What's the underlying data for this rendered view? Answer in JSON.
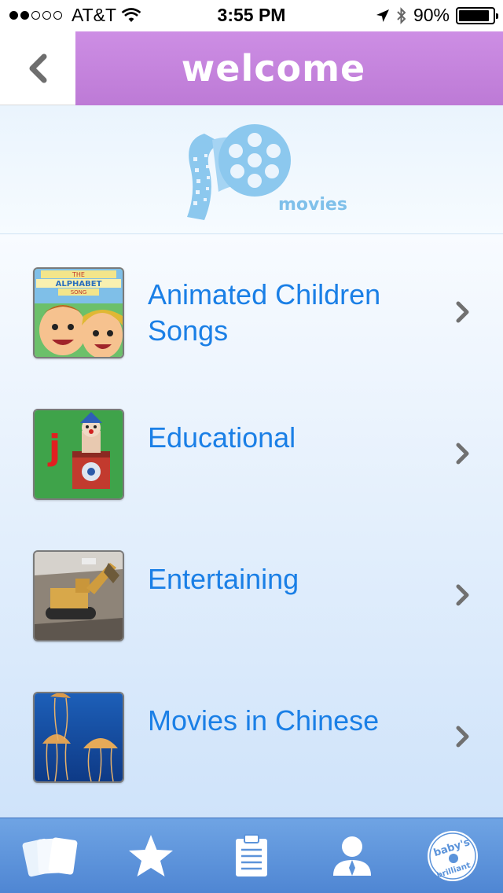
{
  "status_bar": {
    "carrier": "AT&T",
    "time": "3:55 PM",
    "battery_percent": "90%",
    "battery_level": 0.9,
    "signal_bars_filled": 2,
    "signal_bars_total": 5
  },
  "header": {
    "title": "welcome",
    "back_icon": "chevron-left-icon",
    "accent_color": "#c586de"
  },
  "banner": {
    "icon": "film-reel-icon",
    "label": "movies",
    "color": "#7fc0ea"
  },
  "list": {
    "items": [
      {
        "label": "Animated Children Songs",
        "thumb_text": [
          "THE",
          "ALPHABET",
          "SONG"
        ]
      },
      {
        "label": "Educational",
        "thumb_text": [
          "j"
        ]
      },
      {
        "label": "Entertaining"
      },
      {
        "label": "Movies in Chinese"
      }
    ],
    "text_color": "#1a7fe6"
  },
  "tab_bar": {
    "tabs": [
      {
        "icon": "cards-icon"
      },
      {
        "icon": "star-icon"
      },
      {
        "icon": "clipboard-icon"
      },
      {
        "icon": "person-icon"
      },
      {
        "icon": "babys-brilliant-logo",
        "logo_text": "baby's brilliant"
      }
    ],
    "color": "#5b93da"
  }
}
